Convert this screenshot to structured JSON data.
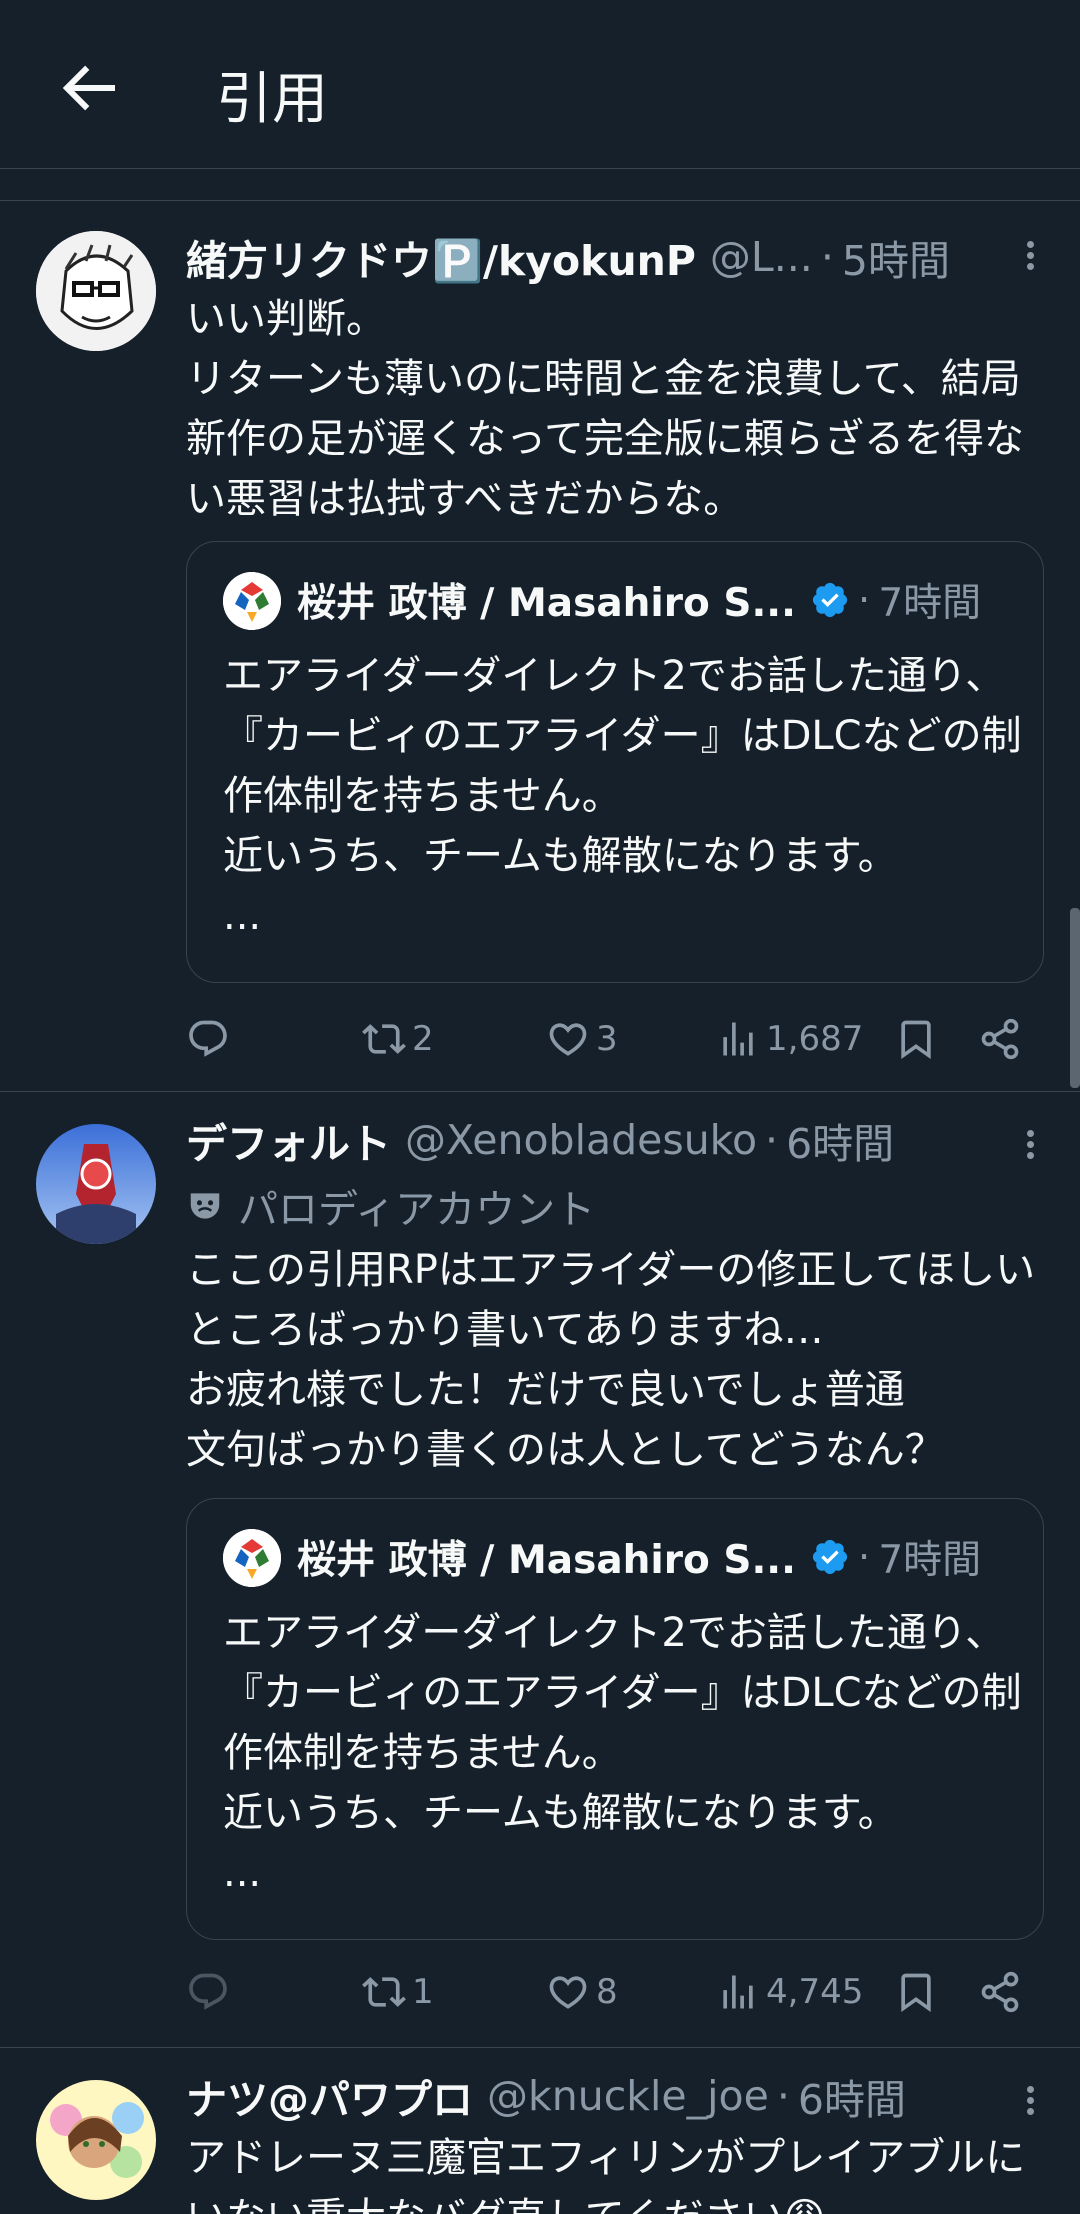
{
  "header": {
    "title": "引用"
  },
  "tweets": [
    {
      "name": "緒方リクドウ🅿️/kyokunP",
      "handle": "@L...",
      "time": "5時間",
      "text": "いい判断。\nリターンも薄いのに時間と金を浪費して、結局新作の足が遅くなって完全版に頼らざるを得ない悪習は払拭すべきだからな。",
      "quote": {
        "name": "桜井 政博 / Masahiro S...",
        "time": "7時間",
        "text": "エアライダーダイレクト2でお話した通り、『カービィのエアライダー』はDLCなどの制作体制を持ちません。\n近いうち、チームも解散になります。\n..."
      },
      "actions": {
        "retweets": "2",
        "likes": "3",
        "views": "1,687"
      }
    },
    {
      "name": "デフォルト",
      "handle": "@Xenobladesuko",
      "time": "6時間",
      "parody_label": "パロディアカウント",
      "text": "ここの引用RPはエアライダーの修正してほしいところばっかり書いてありますね…\nお疲れ様でした！だけで良いでしょ普通\n文句ばっかり書くのは人としてどうなん？",
      "quote": {
        "name": "桜井 政博 / Masahiro S...",
        "time": "7時間",
        "text": "エアライダーダイレクト2でお話した通り、『カービィのエアライダー』はDLCなどの制作体制を持ちません。\n近いうち、チームも解散になります。\n..."
      },
      "actions": {
        "retweets": "1",
        "likes": "8",
        "views": "4,745"
      }
    },
    {
      "name": "ナツ@パワプロ",
      "handle": "@knuckle_joe",
      "time": "6時間",
      "text": "アドレーヌ三魔官エフィリンがプレイアブルにいない重大なバグ直してください😩"
    }
  ]
}
